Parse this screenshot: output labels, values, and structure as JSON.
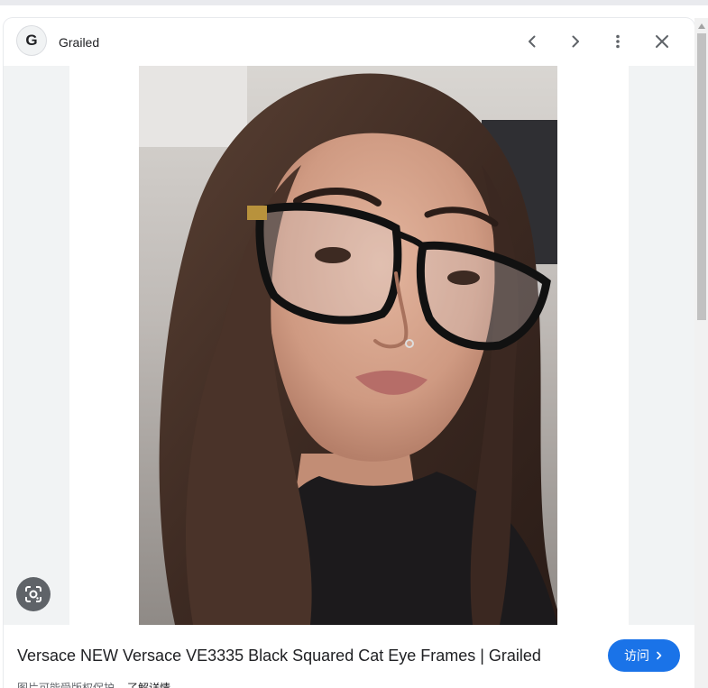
{
  "header": {
    "source_initial": "G",
    "source_name": "Grailed"
  },
  "icons": {
    "prev": "chevron-left-icon",
    "next": "chevron-right-icon",
    "more": "more-vert-icon",
    "close": "close-icon",
    "lens": "google-lens-icon"
  },
  "footer": {
    "title": "Versace NEW Versace VE3335 Black Squared Cat Eye Frames | Grailed",
    "visit_label": "访问",
    "copyright_notice": "图片可能受版权保护。",
    "learn_more": "了解详情"
  },
  "colors": {
    "accent": "#1a73e8",
    "panel_bg": "#f1f3f4",
    "text": "#202124"
  }
}
